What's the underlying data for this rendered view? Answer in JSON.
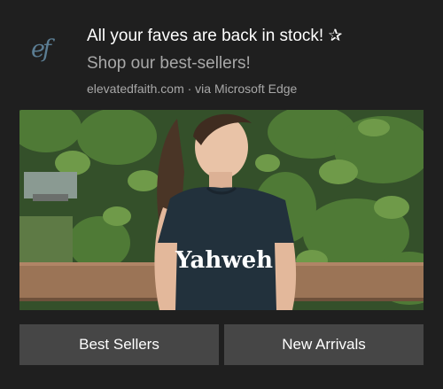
{
  "notification": {
    "app_logo_text": "ef",
    "title": "All your faves are back in stock! ✰",
    "subtitle": "Shop our best-sellers!",
    "attribution": "elevatedfaith.com · via Microsoft Edge"
  },
  "hero_image": {
    "shirt_text": "Yahweh"
  },
  "actions": [
    {
      "label": "Best Sellers"
    },
    {
      "label": "New Arrivals"
    }
  ],
  "colors": {
    "background": "#1f1f1f",
    "button_background": "#464646",
    "secondary_text": "#a8a8a8",
    "logo": "#5b7d93"
  }
}
